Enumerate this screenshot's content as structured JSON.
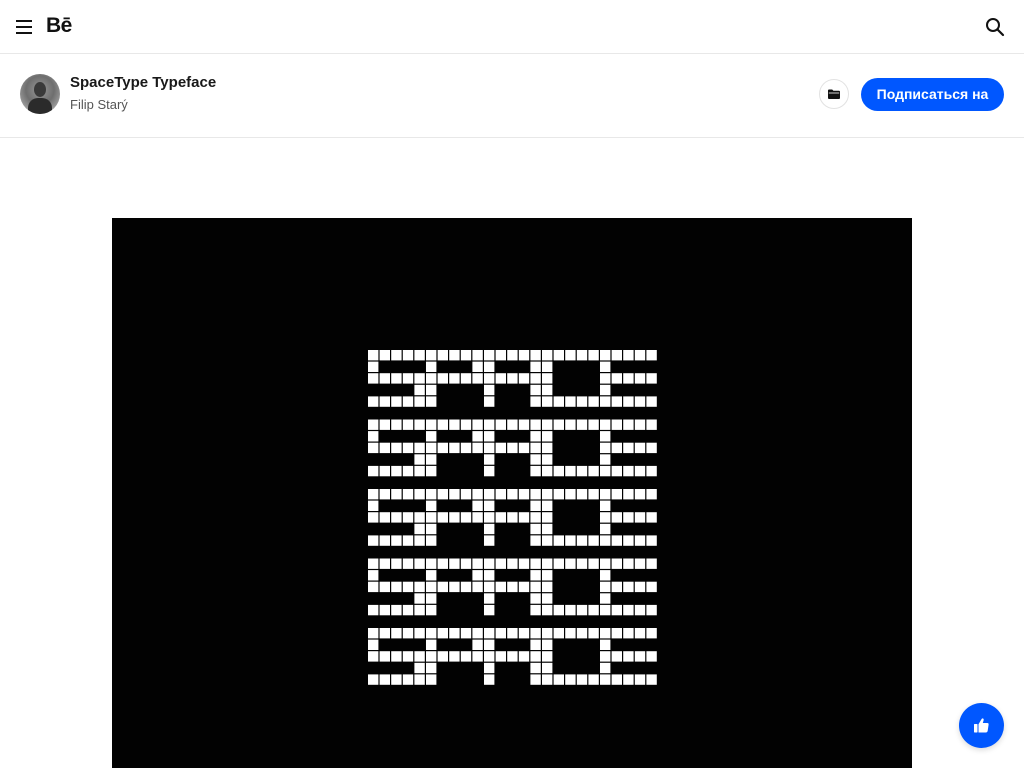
{
  "nav": {
    "logo": "Bē",
    "menu_icon": "hamburger-menu-icon",
    "search_icon": "search-icon"
  },
  "project": {
    "title": "SpaceType Typeface",
    "author": "Filip Starý",
    "save_icon": "folder-icon",
    "follow_label": "Подписаться на"
  },
  "artwork": {
    "word": "SPACE",
    "lines": [
      "SPACE",
      "SPACE",
      "SPACE",
      "SPACE",
      "SPACE"
    ],
    "background": "#020202",
    "glyph_color": "#ffffff"
  },
  "appreciate": {
    "icon": "thumbs-up-icon"
  },
  "colors": {
    "accent": "#0057ff"
  }
}
